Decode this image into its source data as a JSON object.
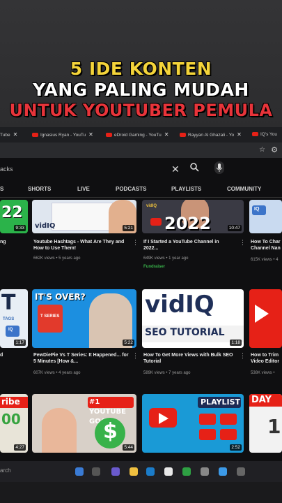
{
  "caption": {
    "line1": "5 IDE KONTEN",
    "line2": "YANG PALING MUDAH",
    "line3": "UNTUK YOUTUBER PEMULA"
  },
  "browser": {
    "tabs": [
      "Tube",
      "Ignasius Ryan - YouTu",
      "eDroid Gaming - YouTu",
      "Rayyan Al Ghazali - Yo",
      "IQ's You"
    ]
  },
  "search": {
    "query": "acks"
  },
  "channel_tabs": [
    "S",
    "SHORTS",
    "LIVE",
    "PODCASTS",
    "PLAYLISTS",
    "COMMUNITY"
  ],
  "videos": [
    {
      "title": "ng",
      "meta": "",
      "duration": "9:33",
      "thumb_text": "22"
    },
    {
      "title": "Youtube Hashtags - What Are They and How to Use Them!",
      "meta": "662K views • 5 years ago",
      "duration": "5:21",
      "thumb_text": "vidIQ"
    },
    {
      "title": "If I Started a YouTube Channel in 2022...",
      "meta": "649K views • 1 year ago",
      "badge": "Fundraiser",
      "duration": "10:47",
      "thumb_text": "2022"
    },
    {
      "title": "How To Char Channel Nan",
      "meta": "615K views • 4",
      "duration": "",
      "thumb_text": "IQ"
    },
    {
      "title": "d",
      "meta": "",
      "duration": "1:17",
      "thumb_text": "T"
    },
    {
      "title": "PewDiePie Vs T Series: It Happened... for 5 Minutes [How &...",
      "meta": "607K views • 4 years ago",
      "duration": "5:22",
      "thumb_text": "IT'S OVER?"
    },
    {
      "title": "How To Get More Views with Bulk SEO Tutorial",
      "meta": "589K views • 7 years ago",
      "duration": "1:18",
      "thumb_text": "SEO TUTORIAL"
    },
    {
      "title": "How to Trim Video Editor",
      "meta": "538K views •",
      "duration": "",
      "thumb_text": ""
    },
    {
      "title": "",
      "meta": "",
      "duration": "4:27",
      "thumb_text": "ribe"
    },
    {
      "title": "",
      "meta": "",
      "duration": "5:44",
      "thumb_text": "#1 YOUTUBE GOAL!"
    },
    {
      "title": "",
      "meta": "",
      "duration": "2:52",
      "thumb_text": "PLAYLIST"
    },
    {
      "title": "",
      "meta": "",
      "duration": "",
      "thumb_text": "DAY"
    }
  ],
  "thumb_extras": {
    "v3_brand": "vidIQ",
    "v4_brand": "IQ",
    "v5_tags": "TAGS",
    "v5_tag2": "IQ",
    "v6_logo": "T SERIES",
    "v9_count": "00",
    "v10_sign": "$",
    "v12_day": "1"
  },
  "taskbar": {
    "search_placeholder": "arch"
  }
}
